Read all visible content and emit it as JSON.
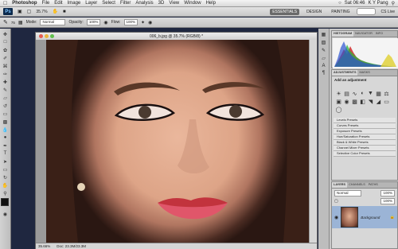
{
  "menubar": {
    "app_name": "Photoshop",
    "menus": [
      "File",
      "Edit",
      "Image",
      "Layer",
      "Select",
      "Filter",
      "Analysis",
      "3D",
      "View",
      "Window",
      "Help"
    ],
    "clock": "Sat 06:46",
    "user": "K Y Pang"
  },
  "appbar": {
    "zoom": "35.7%",
    "workspaces": [
      "ESSENTIALS",
      "DESIGN",
      "PAINTING"
    ],
    "cs_live": "CS Live"
  },
  "options": {
    "mode_label": "Mode:",
    "mode_value": "Normal",
    "opacity_label": "Opacity:",
    "opacity_value": "100%",
    "flow_label": "Flow:",
    "flow_value": "100%",
    "brush_size": "75"
  },
  "document": {
    "title": "006_b.jpg @ 35.7% (RGB/8) *",
    "zoom_status": "35.66%",
    "doc_size": "Doc: 23.3M/23.3M"
  },
  "panels": {
    "top_tabs": [
      "HISTOGRAM",
      "NAVIGATOR",
      "INFO"
    ],
    "adj_tabs": [
      "ADJUSTMENTS",
      "MASKS"
    ],
    "adj_heading": "Add an adjustment",
    "presets": [
      "Levels Presets",
      "Curves Presets",
      "Exposure Presets",
      "Hue/Saturation Presets",
      "Black & White Presets",
      "Channel Mixer Presets",
      "Selective Color Presets"
    ],
    "layers_tabs": [
      "LAYERS",
      "CHANNELS",
      "PATHS"
    ],
    "blend_mode": "Normal",
    "layer_opacity": "100%",
    "layer_fill": "100%",
    "layer_name": "Background"
  },
  "colors": {
    "accent": "#9bb4d6",
    "ps_logo": "#0c2a4d"
  }
}
